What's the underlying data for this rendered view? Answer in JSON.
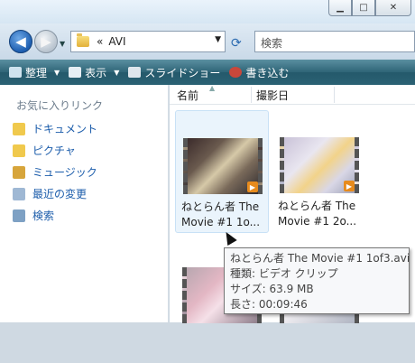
{
  "window": {
    "minimize_glyph": "▁",
    "maximize_glyph": "□",
    "close_glyph": "✕"
  },
  "nav": {
    "back_glyph": "◀",
    "forward_glyph": "▶",
    "dropdown_glyph": "▼"
  },
  "address": {
    "chevron": "«",
    "path": "AVI",
    "dropdown_glyph": "▼",
    "refresh_glyph": "⟳"
  },
  "search": {
    "placeholder": "検索"
  },
  "toolbar": {
    "organize_label": "整理",
    "view_label": "表示",
    "slideshow_label": "スライドショー",
    "burn_label": "書き込む",
    "arrow_glyph": "▼"
  },
  "nav_pane": {
    "title": "お気に入りリンク",
    "links": [
      {
        "label": "ドキュメント",
        "icon": "documents-icon"
      },
      {
        "label": "ピクチャ",
        "icon": "pictures-icon"
      },
      {
        "label": "ミュージック",
        "icon": "music-icon"
      },
      {
        "label": "最近の変更",
        "icon": "recent-changes-icon"
      },
      {
        "label": "検索",
        "icon": "search-folder-icon"
      }
    ]
  },
  "columns": {
    "name": "名前",
    "date_taken": "撮影日",
    "sort_glyph": "▲"
  },
  "files": [
    {
      "label": "ねとらん者 The Movie #1 1o...",
      "selected": true
    },
    {
      "label": "ねとらん者 The Movie #1 2o...",
      "selected": false
    },
    {
      "label": "",
      "selected": false
    },
    {
      "label": "",
      "selected": false
    }
  ],
  "play_glyph": "▶",
  "tooltip": {
    "filename": "ねとらん者 The Movie #1 1of3.avi",
    "type": "種類: ビデオ クリップ",
    "size": "サイズ: 63.9 MB",
    "length": "長さ: 00:09:46"
  },
  "colors": {
    "toolbar": "#2e6476",
    "link": "#1c5dab",
    "selection": "#eaf4fc",
    "play_badge": "#e78b1d"
  }
}
